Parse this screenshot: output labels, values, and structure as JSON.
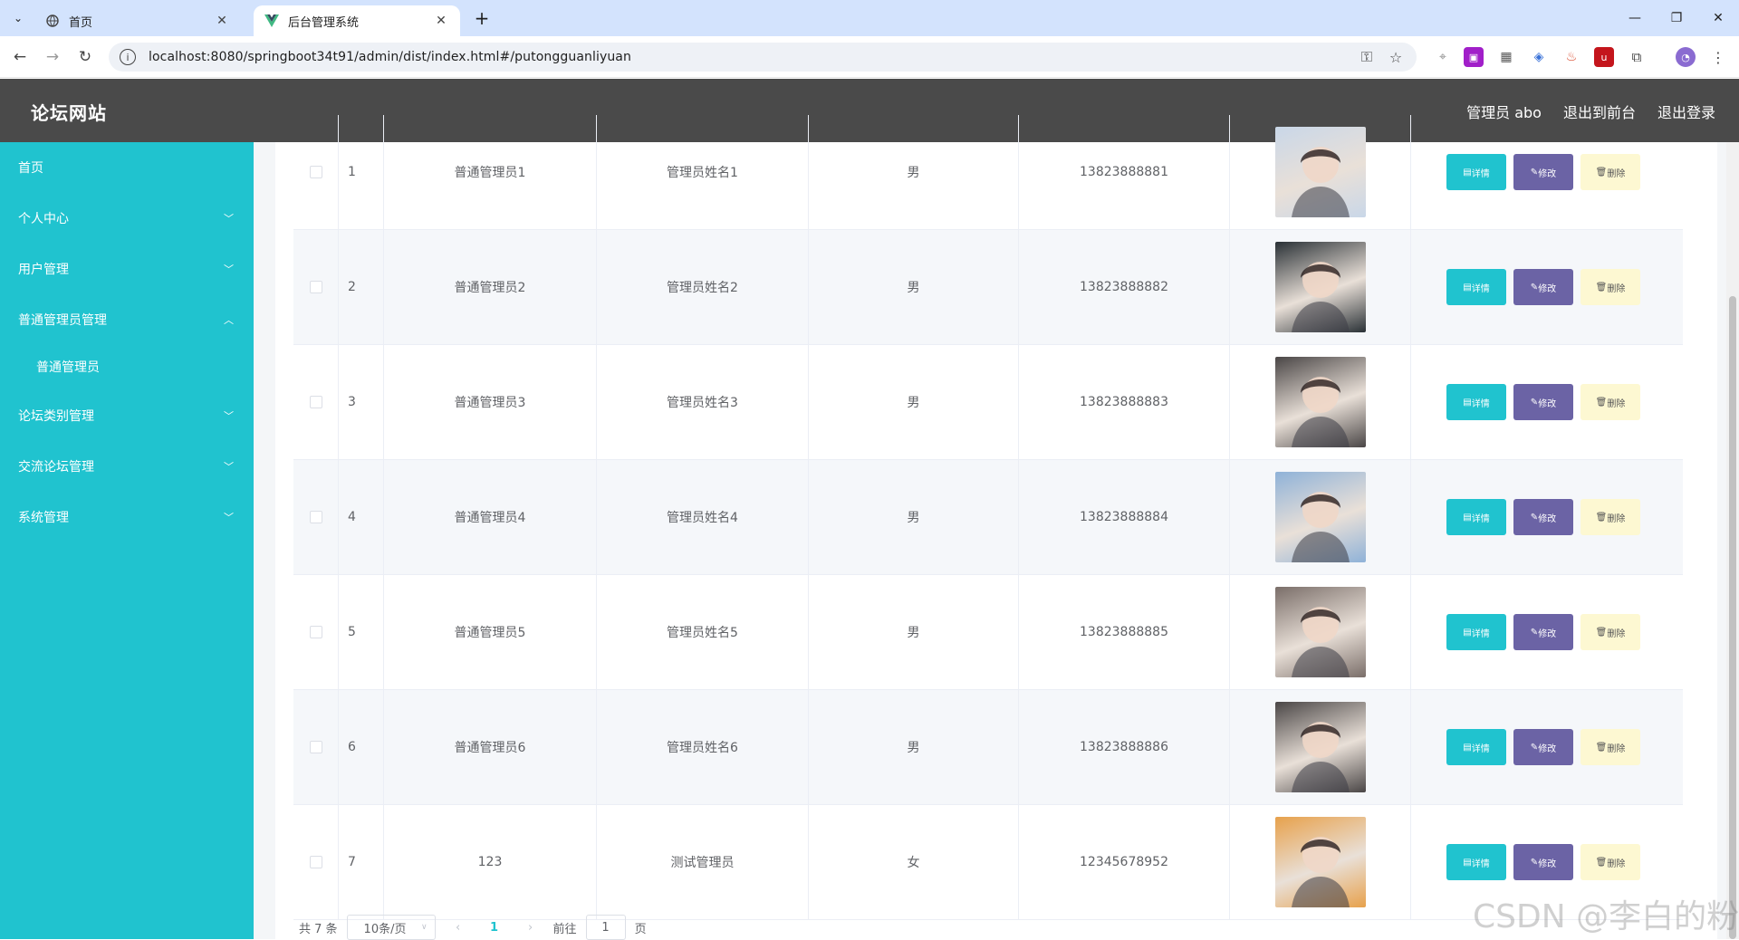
{
  "browser": {
    "tabs": [
      {
        "title": "首页",
        "active": false
      },
      {
        "title": "后台管理系统",
        "active": true
      }
    ],
    "url": "localhost:8080/springboot34t91/admin/dist/index.html#/putongguanliyuan"
  },
  "header": {
    "brand": "论坛网站",
    "user": "管理员 abo",
    "to_front": "退出到前台",
    "logout": "退出登录"
  },
  "sidebar": {
    "items": [
      {
        "label": "首页",
        "expandable": false
      },
      {
        "label": "个人中心",
        "expandable": true
      },
      {
        "label": "用户管理",
        "expandable": true
      },
      {
        "label": "普通管理员管理",
        "expandable": true,
        "open": true
      },
      {
        "label": "普通管理员",
        "sub": true
      },
      {
        "label": "论坛类别管理",
        "expandable": true
      },
      {
        "label": "交流论坛管理",
        "expandable": true
      },
      {
        "label": "系统管理",
        "expandable": true
      }
    ]
  },
  "table": {
    "rows": [
      {
        "index": "1",
        "account": "普通管理员1",
        "name": "管理员姓名1",
        "gender": "男",
        "phone": "13823888881",
        "avatar_color": "#c9d7e8"
      },
      {
        "index": "2",
        "account": "普通管理员2",
        "name": "管理员姓名2",
        "gender": "男",
        "phone": "13823888882",
        "avatar_color": "#2a3136"
      },
      {
        "index": "3",
        "account": "普通管理员3",
        "name": "管理员姓名3",
        "gender": "男",
        "phone": "13823888883",
        "avatar_color": "#4a4646"
      },
      {
        "index": "4",
        "account": "普通管理员4",
        "name": "管理员姓名4",
        "gender": "男",
        "phone": "13823888884",
        "avatar_color": "#8fb2d8"
      },
      {
        "index": "5",
        "account": "普通管理员5",
        "name": "管理员姓名5",
        "gender": "男",
        "phone": "13823888885",
        "avatar_color": "#7a6e69"
      },
      {
        "index": "6",
        "account": "普通管理员6",
        "name": "管理员姓名6",
        "gender": "男",
        "phone": "13823888886",
        "avatar_color": "#4a4646"
      },
      {
        "index": "7",
        "account": "123",
        "name": "测试管理员",
        "gender": "女",
        "phone": "12345678952",
        "avatar_color": "#e7a14c"
      }
    ],
    "actions": {
      "detail": "详情",
      "edit": "修改",
      "delete": "删除"
    }
  },
  "pager": {
    "total": "共 7 条",
    "page_size": "10条/页",
    "current": "1",
    "goto_label": "前往",
    "goto_value": "1",
    "page_unit": "页"
  },
  "watermark": "CSDN @李白的粉",
  "colors": {
    "sidebar": "#20c3cf",
    "header": "#4a4a4a",
    "btn_detail": "#20c3cf",
    "btn_edit": "#6b63a5",
    "btn_delete": "#fdf8d2"
  }
}
